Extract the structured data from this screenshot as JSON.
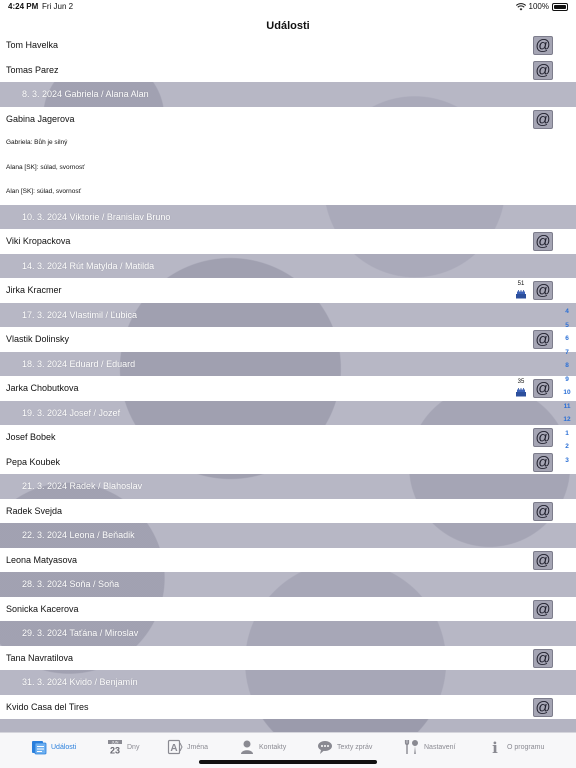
{
  "status": {
    "time": "4:24 PM",
    "date": "Fri Jun 2",
    "battery": "100%"
  },
  "nav": {
    "title": "Události"
  },
  "rows": [
    {
      "type": "person",
      "name": "Tom Havelka"
    },
    {
      "type": "person",
      "name": "Tomas Parez"
    },
    {
      "type": "header",
      "label": "8. 3. 2024 Gabriela / Alana Alan"
    },
    {
      "type": "person",
      "name": "Gabina Jagerova"
    },
    {
      "type": "note",
      "name": "Gabriela: Bůh je silný"
    },
    {
      "type": "note",
      "name": "Alana [SK]: súlad, svornosť"
    },
    {
      "type": "note",
      "name": "Alan [SK]: súlad, svornosť"
    },
    {
      "type": "header",
      "label": "10. 3. 2024 Viktorie / Branislav Bruno"
    },
    {
      "type": "person",
      "name": "Viki Kropackova"
    },
    {
      "type": "header",
      "label": "14. 3. 2024 Rút Matylda / Matilda"
    },
    {
      "type": "person",
      "name": "Jirka Kracmer",
      "age": "51"
    },
    {
      "type": "header",
      "label": "17. 3. 2024 Vlastimil / Ľubica"
    },
    {
      "type": "person",
      "name": "Vlastik Dolinsky"
    },
    {
      "type": "header",
      "label": "18. 3. 2024 Eduard / Eduard"
    },
    {
      "type": "person",
      "name": "Jarka Chobutkova",
      "age": "35"
    },
    {
      "type": "header",
      "label": "19. 3. 2024 Josef / Jozef"
    },
    {
      "type": "person",
      "name": "Josef Bobek"
    },
    {
      "type": "person",
      "name": "Pepa Koubek"
    },
    {
      "type": "header",
      "label": "21. 3. 2024 Radek / Blahoslav"
    },
    {
      "type": "person",
      "name": "Radek Svejda"
    },
    {
      "type": "header",
      "label": "22. 3. 2024 Leona / Beňadik"
    },
    {
      "type": "person",
      "name": "Leona Matyasova"
    },
    {
      "type": "header",
      "label": "28. 3. 2024 Soňa / Soňa"
    },
    {
      "type": "person",
      "name": "Sonicka Kacerova"
    },
    {
      "type": "header",
      "label": "29. 3. 2024 Taťána / Miroslav"
    },
    {
      "type": "person",
      "name": "Tana Navratilova"
    },
    {
      "type": "header",
      "label": "31. 3. 2024 Kvido / Benjamín"
    },
    {
      "type": "person",
      "name": "Kvido Casa del Tires"
    }
  ],
  "email_symbol": "@",
  "index": [
    "4",
    "5",
    "6",
    "7",
    "8",
    "9",
    "10",
    "11",
    "12",
    "1",
    "2",
    "3"
  ],
  "tabs": [
    {
      "label": "Události",
      "icon": "events-icon",
      "active": true
    },
    {
      "label": "Dny",
      "icon": "calendar-icon",
      "calendar_month": "JUN",
      "calendar_day": "23"
    },
    {
      "label": "Jména",
      "icon": "names-icon",
      "glyph": "A"
    },
    {
      "label": "Kontakty",
      "icon": "contacts-icon"
    },
    {
      "label": "Texty zpráv",
      "icon": "messages-icon"
    },
    {
      "label": "Nastavení",
      "icon": "settings-icon"
    },
    {
      "label": "O programu",
      "icon": "info-icon",
      "glyph": "i"
    }
  ],
  "colors": {
    "accent": "#2a7fdc",
    "header_bg": "#b4b4c2",
    "button_bg": "#a5a5b4"
  }
}
